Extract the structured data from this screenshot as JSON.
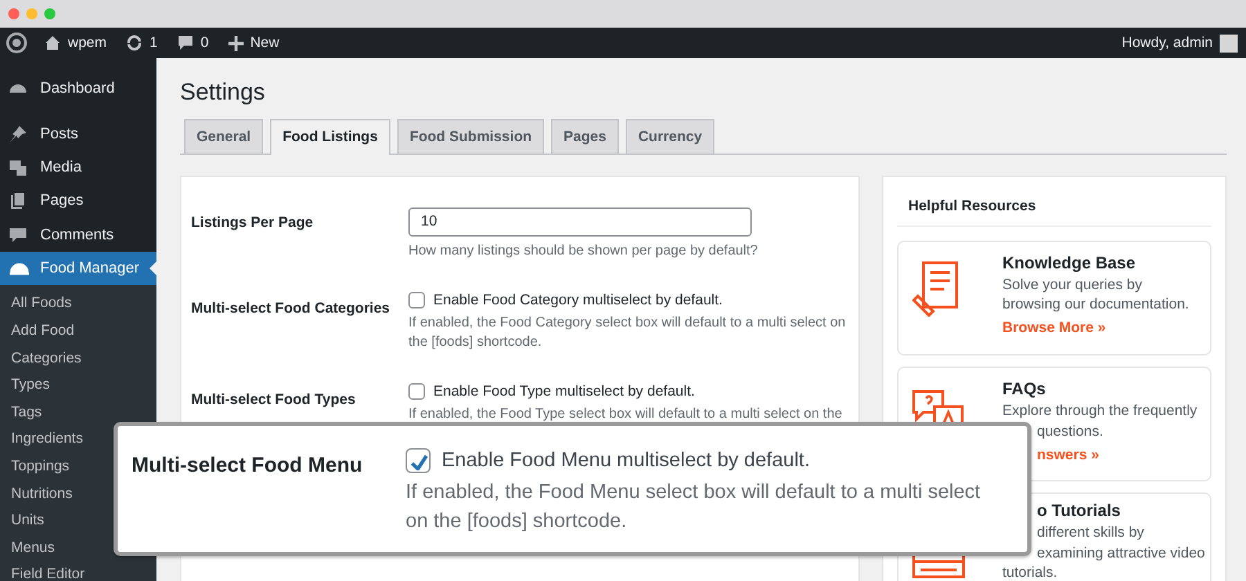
{
  "window": {
    "controls": [
      {
        "color": "#ff5f57"
      },
      {
        "color": "#febc2e"
      },
      {
        "color": "#28c840"
      }
    ]
  },
  "admin_bar": {
    "site": "wpem",
    "updates": "1",
    "comments": "0",
    "new": "New",
    "greeting": "Howdy, admin"
  },
  "sidebar": {
    "items": [
      {
        "label": "Dashboard",
        "selected": false
      },
      {
        "label": "Posts",
        "selected": false
      },
      {
        "label": "Media",
        "selected": false
      },
      {
        "label": "Pages",
        "selected": false
      },
      {
        "label": "Comments",
        "selected": false
      },
      {
        "label": "Food Manager",
        "selected": true,
        "children": [
          {
            "label": "All Foods"
          },
          {
            "label": "Add Food"
          },
          {
            "label": "Categories"
          },
          {
            "label": "Types"
          },
          {
            "label": "Tags"
          },
          {
            "label": "Ingredients"
          },
          {
            "label": "Toppings"
          },
          {
            "label": "Nutritions"
          },
          {
            "label": "Units"
          },
          {
            "label": "Menus"
          },
          {
            "label": "Field Editor"
          }
        ]
      }
    ]
  },
  "page": {
    "title": "Settings"
  },
  "tabs": [
    {
      "label": "General",
      "selected": false
    },
    {
      "label": "Food Listings",
      "selected": true
    },
    {
      "label": "Food Submission",
      "selected": false
    },
    {
      "label": "Pages",
      "selected": false
    },
    {
      "label": "Currency",
      "selected": false
    }
  ],
  "settings": [
    {
      "kind": "text",
      "label": "Listings Per Page",
      "value": "10",
      "help": "How many listings should be shown per page by default?"
    },
    {
      "kind": "checkbox",
      "label": "Multi-select Food Categories",
      "checked": false,
      "caption": "Enable Food Category multiselect by default.",
      "help": "If enabled, the Food Category select box will default to a multi select on the [foods] shortcode."
    },
    {
      "kind": "checkbox",
      "label": "Multi-select Food Types",
      "checked": false,
      "caption": "Enable Food Type multiselect by default.",
      "help": "If enabled, the Food Type select box will default to a multi select on the"
    }
  ],
  "callout": {
    "label": "Multi-select Food Menu",
    "checked": true,
    "caption": "Enable Food Menu multiselect by default.",
    "help": "If enabled, the Food Menu select box will default to a multi select on the [foods] shortcode."
  },
  "resources": {
    "title": "Helpful Resources",
    "cards": [
      {
        "lines": [
          {
            "kind": "title",
            "text": "Knowledge Base"
          },
          {
            "kind": "text",
            "text": "Solve your queries by browsing our documentation."
          },
          {
            "kind": "link",
            "text": "Browse More »"
          }
        ]
      },
      {
        "lines": [
          {
            "kind": "title",
            "text": "FAQs"
          },
          {
            "kind": "text",
            "text": "Explore through the frequently"
          },
          {
            "kind": "text",
            "text": "questions.",
            "covered": true
          },
          {
            "kind": "link",
            "text": "nswers »",
            "covered": true
          }
        ]
      },
      {
        "lines": [
          {
            "kind": "title",
            "text": "o Tutorials",
            "covered": true
          },
          {
            "kind": "text",
            "text": "different skills by",
            "covered": true
          },
          {
            "kind": "text",
            "text": "examining attractive video",
            "covered": true
          },
          {
            "kind": "text",
            "text": "tutorials."
          }
        ]
      }
    ]
  }
}
